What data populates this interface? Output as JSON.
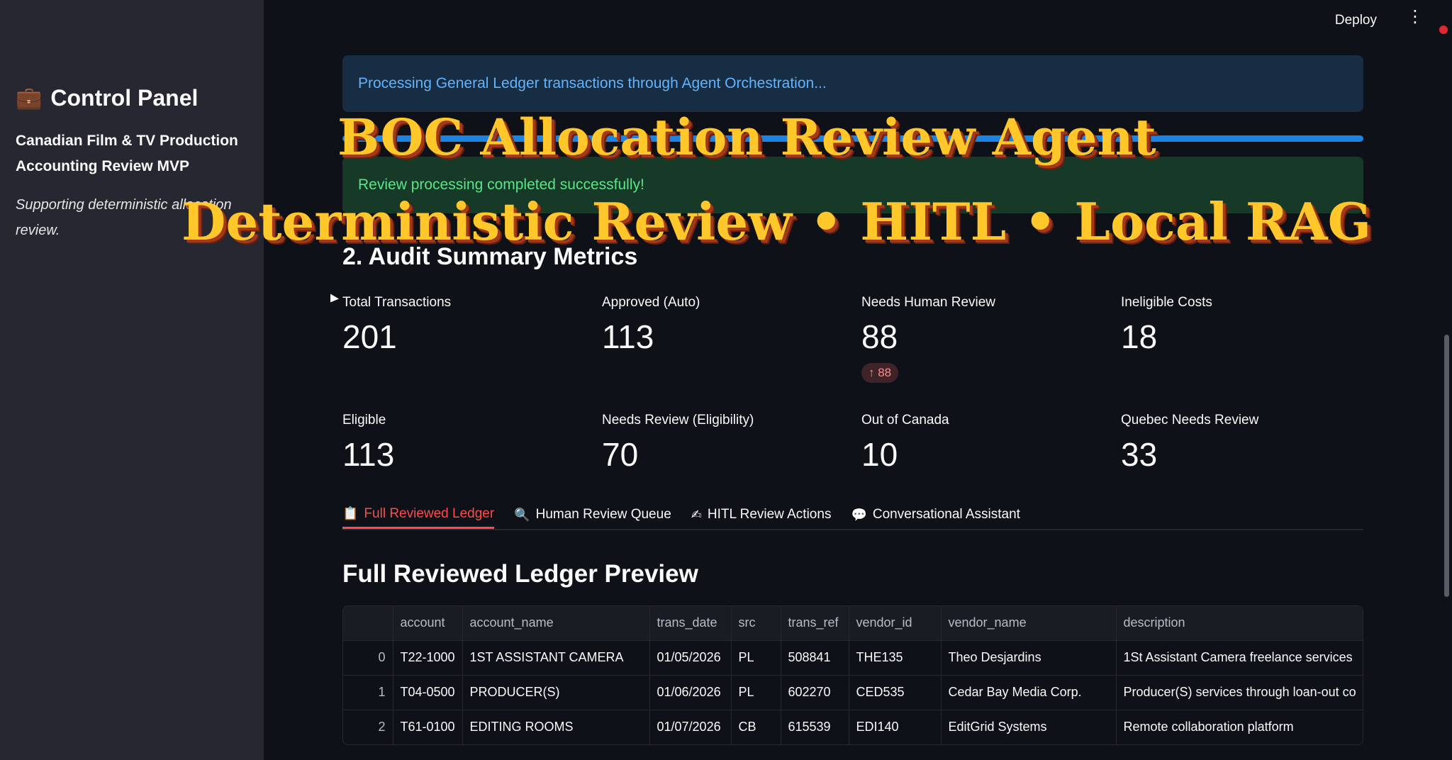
{
  "sidebar": {
    "title": "Control Panel",
    "title_icon": "briefcase-icon",
    "subtitle": "Canadian Film & TV Production Accounting Review MVP",
    "caption": "Supporting deterministic allocation review."
  },
  "topbar": {
    "deploy_label": "Deploy",
    "menu_icon": "vertical-dots-icon"
  },
  "alerts": {
    "info": "Processing General Ledger transactions through Agent Orchestration...",
    "success": "Review processing completed successfully!",
    "progress_fraction": 1.0
  },
  "overlay": {
    "line1": "BOC Allocation Review Agent",
    "line2": "Deterministic Review • HITL • Local RAG"
  },
  "summary": {
    "title": "2. Audit Summary Metrics",
    "metrics": [
      {
        "label": "Total Transactions",
        "value": "201"
      },
      {
        "label": "Approved (Auto)",
        "value": "113"
      },
      {
        "label": "Needs Human Review",
        "value": "88",
        "delta": "↑ 88"
      },
      {
        "label": "Ineligible Costs",
        "value": "18"
      },
      {
        "label": "Eligible",
        "value": "113"
      },
      {
        "label": "Needs Review (Eligibility)",
        "value": "70"
      },
      {
        "label": "Out of Canada",
        "value": "10"
      },
      {
        "label": "Quebec Needs Review",
        "value": "33"
      }
    ]
  },
  "tabs": [
    {
      "label": "Full Reviewed Ledger",
      "icon": "clipboard-icon",
      "glyph": "📋"
    },
    {
      "label": "Human Review Queue",
      "icon": "magnifier-icon",
      "glyph": "🔍"
    },
    {
      "label": "HITL Review Actions",
      "icon": "writing-hand-icon",
      "glyph": "✍"
    },
    {
      "label": "Conversational Assistant",
      "icon": "speech-bubble-icon",
      "glyph": "💬"
    }
  ],
  "ledger": {
    "title": "Full Reviewed Ledger Preview",
    "columns": [
      "",
      "account",
      "account_name",
      "trans_date",
      "src",
      "trans_ref",
      "vendor_id",
      "vendor_name",
      "description"
    ],
    "rows": [
      [
        "0",
        "T22-1000",
        "1ST ASSISTANT CAMERA",
        "01/05/2026",
        "PL",
        "508841",
        "THE135",
        "Theo Desjardins",
        "1St Assistant Camera freelance services"
      ],
      [
        "1",
        "T04-0500",
        "PRODUCER(S)",
        "01/06/2026",
        "PL",
        "602270",
        "CED535",
        "Cedar Bay Media Corp.",
        "Producer(S) services through loan-out co"
      ],
      [
        "2",
        "T61-0100",
        "EDITING ROOMS",
        "01/07/2026",
        "CB",
        "615539",
        "EDI140",
        "EditGrid Systems",
        "Remote collaboration platform"
      ]
    ]
  }
}
